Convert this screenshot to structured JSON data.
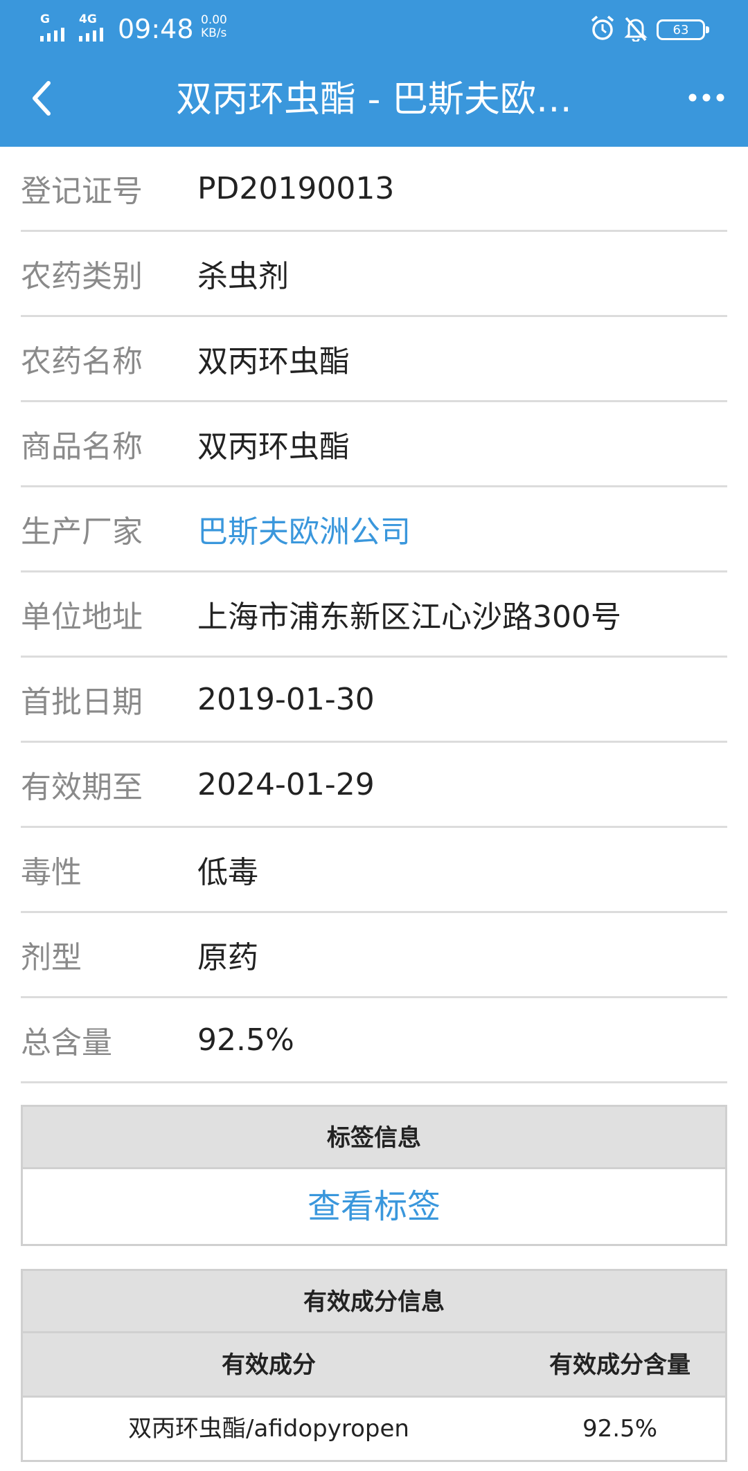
{
  "status_bar": {
    "signal1_label": "G",
    "signal2_label": "4G",
    "time": "09:48",
    "net_speed_value": "0.00",
    "net_speed_unit": "KB/s",
    "battery": "63"
  },
  "nav": {
    "title": "双丙环虫酯 - 巴斯夫欧…"
  },
  "info_rows": [
    {
      "label": "登记证号",
      "value": "PD20190013"
    },
    {
      "label": "农药类别",
      "value": "杀虫剂"
    },
    {
      "label": "农药名称",
      "value": "双丙环虫酯"
    },
    {
      "label": "商品名称",
      "value": "双丙环虫酯"
    },
    {
      "label": "生产厂家",
      "value": "巴斯夫欧洲公司"
    },
    {
      "label": "单位地址",
      "value": "上海市浦东新区江心沙路300号"
    },
    {
      "label": "首批日期",
      "value": "2019-01-30"
    },
    {
      "label": "有效期至",
      "value": "2024-01-29"
    },
    {
      "label": "毒性",
      "value": "低毒"
    },
    {
      "label": "剂型",
      "value": "原药"
    },
    {
      "label": "总含量",
      "value": "92.5%"
    }
  ],
  "label_section": {
    "title": "标签信息",
    "link": "查看标签"
  },
  "ingredient_section": {
    "title": "有效成分信息",
    "columns": [
      "有效成分",
      "有效成分含量"
    ],
    "rows": [
      {
        "name": "双丙环虫酯/afidopyropen",
        "content": "92.5%"
      }
    ]
  },
  "colors": {
    "header_bg": "#3a97dc",
    "link": "#3a97dc",
    "label_text": "#8a8a8a",
    "divider": "#dcdcdc"
  }
}
